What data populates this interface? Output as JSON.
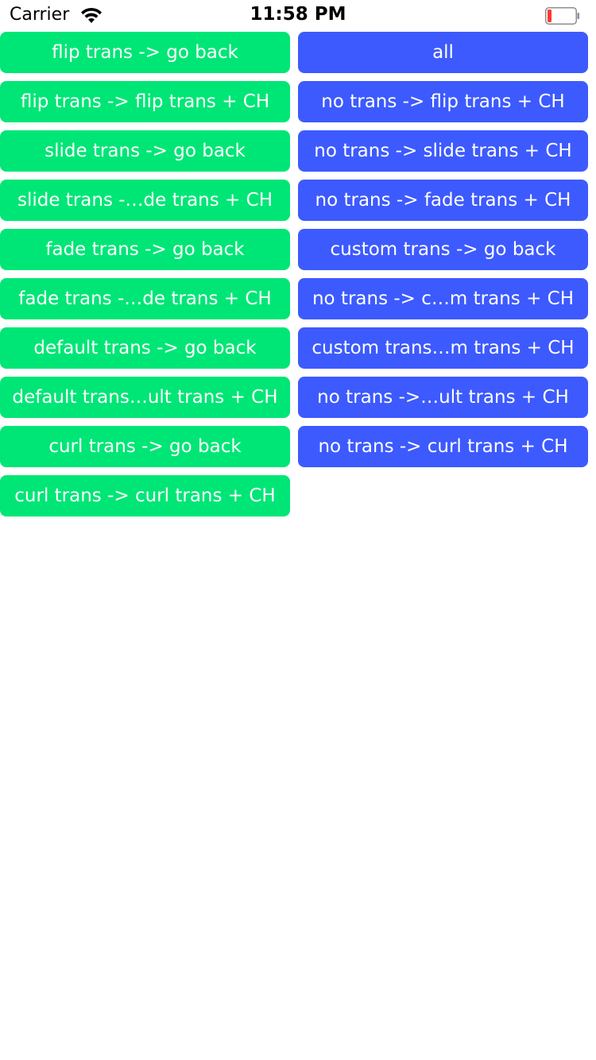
{
  "status_bar": {
    "carrier": "Carrier",
    "time": "11:58 PM",
    "battery_color": "#ff3b30"
  },
  "colors": {
    "left_button": "#00e676",
    "right_button": "#3d5afe"
  },
  "left_buttons": [
    "flip trans -> go back",
    "flip trans -> flip trans + CH",
    "slide trans -> go back",
    "slide trans -…de trans + CH",
    "fade trans -> go back",
    "fade trans -…de trans + CH",
    "default trans -> go back",
    "default trans…ult trans + CH",
    "curl trans -> go back",
    "curl trans -> curl trans + CH"
  ],
  "right_buttons": [
    "all",
    "no trans -> flip trans + CH",
    "no trans -> slide trans + CH",
    "no trans -> fade trans + CH",
    "custom trans -> go back",
    "no trans -> c…m trans + CH",
    "custom trans…m trans + CH",
    "no trans ->…ult trans + CH",
    "no trans -> curl trans + CH"
  ]
}
